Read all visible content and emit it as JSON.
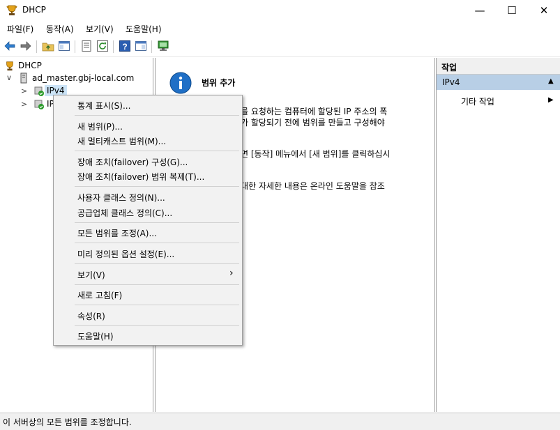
{
  "window": {
    "title": "DHCP",
    "controls": {
      "minimize": "—",
      "maximize": "☐",
      "close": "✕"
    }
  },
  "menubar": [
    {
      "label": "파일(F)"
    },
    {
      "label": "동작(A)"
    },
    {
      "label": "보기(V)"
    },
    {
      "label": "도움말(H)"
    }
  ],
  "toolbar": {
    "icons": [
      "back-arrow-icon",
      "forward-arrow-icon",
      "folder-up-icon",
      "show-hide-tree-icon",
      "properties-icon",
      "refresh-icon",
      "help-icon",
      "show-action-pane-icon",
      "computer-icon"
    ]
  },
  "tree": {
    "root": "DHCP",
    "server": "ad_master.gbj-local.com",
    "ipv4": "IPv4",
    "ipv6_partial": "IP",
    "expanded_chevron": "∨",
    "collapsed_chevron": ">"
  },
  "content": {
    "heading": "범위 추가",
    "line1": "를 요청하는 컴퓨터에 할당된 IP 주소의 폭",
    "line2": "가 할당되기 전에 범위를 만들고 구성해야",
    "line3": "면 [동작] 메뉴에서 [새 범위]를 클릭하십시",
    "line4": "대한 자세한 내용은 온라인 도움말을 참조"
  },
  "actions": {
    "header": "작업",
    "section": "IPv4",
    "section_arrow": "▲",
    "item": "기타 작업",
    "item_arrow": "▶"
  },
  "context_menu": {
    "items": [
      {
        "label": "통계 표시(S)..."
      },
      {
        "label": "새 범위(P)..."
      },
      {
        "label": "새 멀티캐스트 범위(M)..."
      },
      {
        "label": "장애 조치(failover) 구성(G)..."
      },
      {
        "label": "장애 조치(failover) 범위 복제(T)..."
      },
      {
        "label": "사용자 클래스 정의(N)..."
      },
      {
        "label": "공급업체 클래스 정의(C)..."
      },
      {
        "label": "모든 범위를 조정(A)..."
      },
      {
        "label": "미리 정의된 옵션 설정(E)..."
      },
      {
        "label": "보기(V)",
        "submenu_arrow": "›"
      },
      {
        "label": "새로 고침(F)"
      },
      {
        "label": "속성(R)"
      },
      {
        "label": "도움말(H)"
      }
    ]
  },
  "status": {
    "text": "이 서버상의 모든 범위를 조정합니다."
  },
  "colors": {
    "selection": "#b8cfe6",
    "info_icon": "#1f6fc6",
    "tree_selected": "#cce4f7"
  }
}
